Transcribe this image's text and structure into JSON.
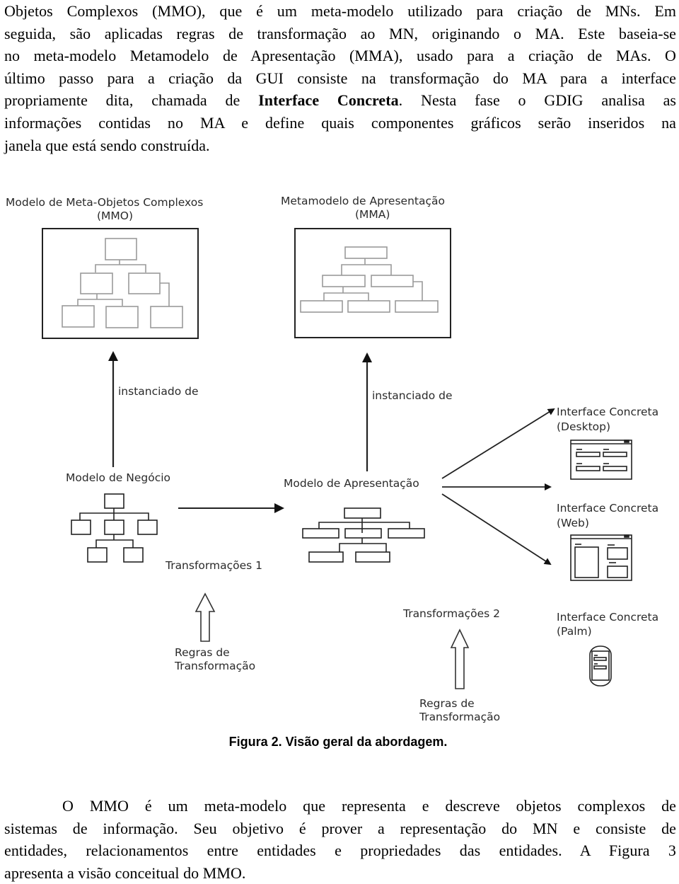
{
  "paragraph_top": {
    "lines": [
      "Objetos Complexos (MMO), que é um meta-modelo utilizado para criação de MNs. Em",
      "seguida, são aplicadas regras de transformação ao MN, originando o MA. Este baseia-se",
      "no meta-modelo Metamodelo de Apresentação (MMA), usado para a criação de MAs. O",
      "último passo para a criação da GUI consiste na transformação do MA para a interface",
      "propriamente dita, chamada de ",
      "Interface Concreta",
      ". Nesta fase o GDIG analisa as",
      "informações contidas no MA e define quais componentes gráficos serão inseridos na",
      "janela que está sendo construída."
    ]
  },
  "figure": {
    "mmo_title_line1": "Modelo de Meta-Objetos Complexos",
    "mmo_title_line2": "(MMO)",
    "mma_title_line1": "Metamodelo de Apresentação",
    "mma_title_line2": "(MMA)",
    "instanciado_left": "instanciado de",
    "instanciado_right": "instanciado de",
    "modelo_negocio": "Modelo de Negócio",
    "modelo_apresentacao": "Modelo de Apresentação",
    "transformacoes_1": "Transformações 1",
    "transformacoes_2": "Transformações 2",
    "regras_1_line1": "Regras de",
    "regras_1_line2": "Transformação",
    "regras_2_line1": "Regras de",
    "regras_2_line2": "Transformação",
    "ic_desktop_line1": "Interface Concreta",
    "ic_desktop_line2": "(Desktop)",
    "ic_web_line1": "Interface Concreta",
    "ic_web_line2": "(Web)",
    "ic_palm_line1": "Interface Concreta",
    "ic_palm_line2": "(Palm)"
  },
  "caption": "Figura 2. Visão geral da abordagem.",
  "paragraph_bottom": {
    "lines": [
      "O MMO é um meta-modelo que representa e descreve objetos complexos de",
      "sistemas de informação. Seu objetivo é prover a representação do MN e consiste de",
      "entidades, relacionamentos entre entidades e propriedades das entidades. A Figura 3",
      "apresenta a visão conceitual do MMO."
    ]
  }
}
